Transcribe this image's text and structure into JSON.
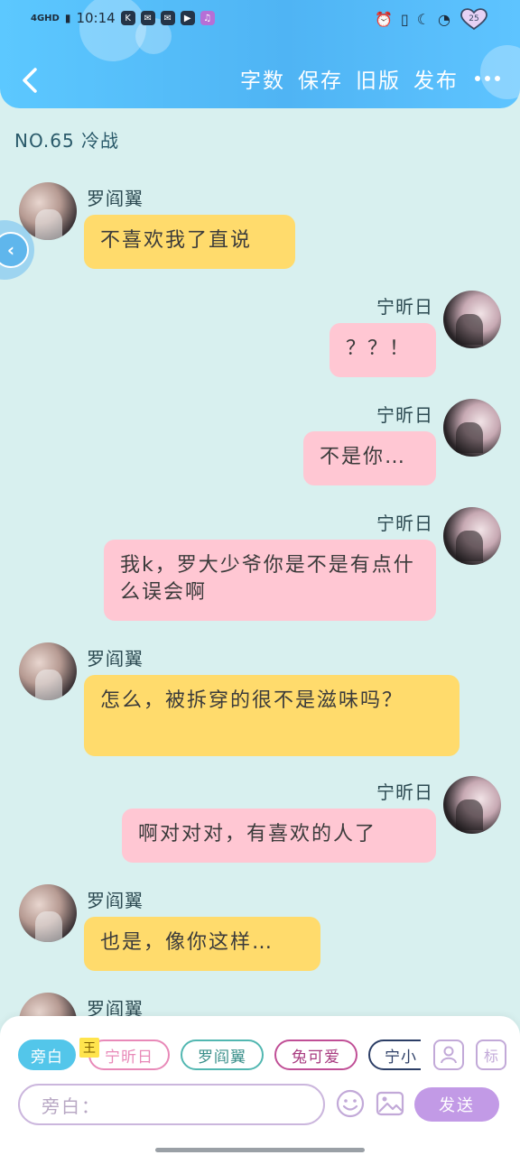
{
  "status_bar": {
    "network": "4GHD",
    "time": "10:14",
    "apps": [
      "K",
      "✉",
      "✉",
      "▶",
      "♫"
    ],
    "battery": "25"
  },
  "nav": {
    "actions": [
      "字数",
      "保存",
      "旧版",
      "发布"
    ]
  },
  "chapter": {
    "title": "NO.65 冷战"
  },
  "messages": [
    {
      "side": "left",
      "color": "yellow",
      "name": "罗阎翼",
      "text": "不喜欢我了直说"
    },
    {
      "side": "right",
      "color": "pink",
      "name": "宁昕日",
      "text": "？？！"
    },
    {
      "side": "right",
      "color": "pink",
      "name": "宁昕日",
      "text": "不是你…"
    },
    {
      "side": "right",
      "color": "pink",
      "name": "宁昕日",
      "text": "我k，罗大少爷你是不是有点什么误会啊"
    },
    {
      "side": "left",
      "color": "yellow",
      "name": "罗阎翼",
      "text": "怎么，被拆穿的很不是滋味吗？"
    },
    {
      "side": "right",
      "color": "pink",
      "name": "宁昕日",
      "text": "啊对对对，有喜欢的人了"
    },
    {
      "side": "left",
      "color": "yellow",
      "name": "罗阎翼",
      "text": "也是，像你这样…"
    },
    {
      "side": "left",
      "color": "yellow",
      "name": "罗阎翼",
      "text": ""
    }
  ],
  "roles": [
    {
      "label": "旁白",
      "color": "#53c6ea",
      "active": true
    },
    {
      "label": "宁昕日",
      "color": "#e889b8",
      "active": false
    },
    {
      "label": "罗阎翼",
      "color": "#52b7b1",
      "active": false
    },
    {
      "label": "兔可爱",
      "color": "#c04f96",
      "active": false
    },
    {
      "label": "宁小",
      "color": "#2c3e66",
      "active": false
    }
  ],
  "role_badge": "王",
  "tools": {
    "character": "person-icon",
    "mark": "标"
  },
  "input": {
    "placeholder": "旁白："
  },
  "send_label": "发送",
  "colors": {
    "header": "#4fb4f4",
    "background": "#d8f0ef",
    "yellow_bubble": "#ffdb6c",
    "pink_bubble": "#ffc7d3",
    "send": "#c29ae6"
  }
}
